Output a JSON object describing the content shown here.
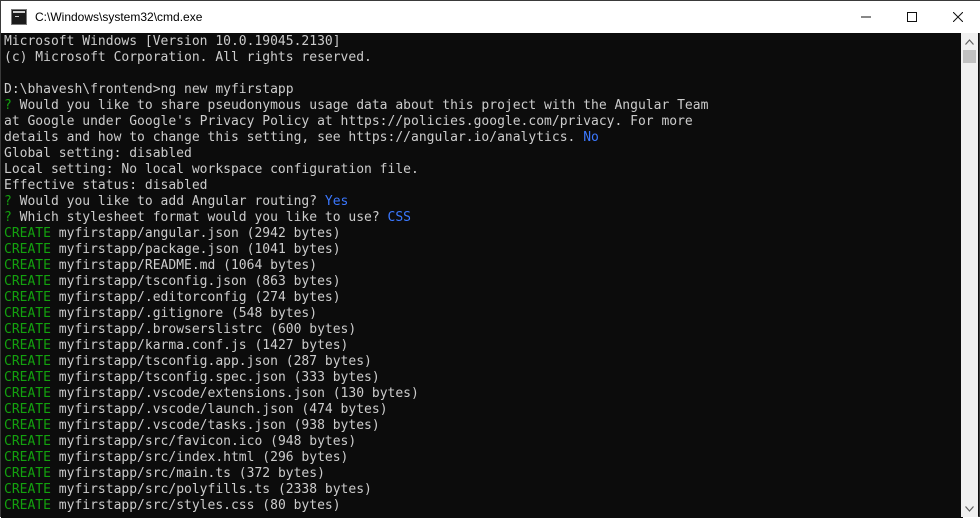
{
  "window": {
    "title": "C:\\Windows\\system32\\cmd.exe",
    "minimize_label": "",
    "maximize_label": "",
    "close_label": ""
  },
  "colors": {
    "terminal_bg": "#0c0c0c",
    "text": "#cccccc",
    "green": "#13a10e",
    "blue": "#3b78ff"
  },
  "terminal": {
    "header": [
      "Microsoft Windows [Version 10.0.19045.2130]",
      "(c) Microsoft Corporation. All rights reserved."
    ],
    "prompt": "D:\\bhavesh\\frontend>ng new myfirstapp",
    "q1": {
      "mark": "?",
      "line1": " Would you like to share pseudonymous usage data about this project with the Angular Team",
      "line2": "at Google under Google's Privacy Policy at https://policies.google.com/privacy. For more",
      "line3": "details and how to change this setting, see https://angular.io/analytics. ",
      "answer": "No"
    },
    "settings": [
      "Global setting: disabled",
      "Local setting: No local workspace configuration file.",
      "Effective status: disabled"
    ],
    "q2": {
      "mark": "?",
      "text": " Would you like to add Angular routing? ",
      "answer": "Yes"
    },
    "q3": {
      "mark": "?",
      "text": " Which stylesheet format would you like to use? ",
      "answer": "CSS"
    },
    "create_label": "CREATE",
    "created_files": [
      " myfirstapp/angular.json (2942 bytes)",
      " myfirstapp/package.json (1041 bytes)",
      " myfirstapp/README.md (1064 bytes)",
      " myfirstapp/tsconfig.json (863 bytes)",
      " myfirstapp/.editorconfig (274 bytes)",
      " myfirstapp/.gitignore (548 bytes)",
      " myfirstapp/.browserslistrc (600 bytes)",
      " myfirstapp/karma.conf.js (1427 bytes)",
      " myfirstapp/tsconfig.app.json (287 bytes)",
      " myfirstapp/tsconfig.spec.json (333 bytes)",
      " myfirstapp/.vscode/extensions.json (130 bytes)",
      " myfirstapp/.vscode/launch.json (474 bytes)",
      " myfirstapp/.vscode/tasks.json (938 bytes)",
      " myfirstapp/src/favicon.ico (948 bytes)",
      " myfirstapp/src/index.html (296 bytes)",
      " myfirstapp/src/main.ts (372 bytes)",
      " myfirstapp/src/polyfills.ts (2338 bytes)",
      " myfirstapp/src/styles.css (80 bytes)"
    ]
  }
}
